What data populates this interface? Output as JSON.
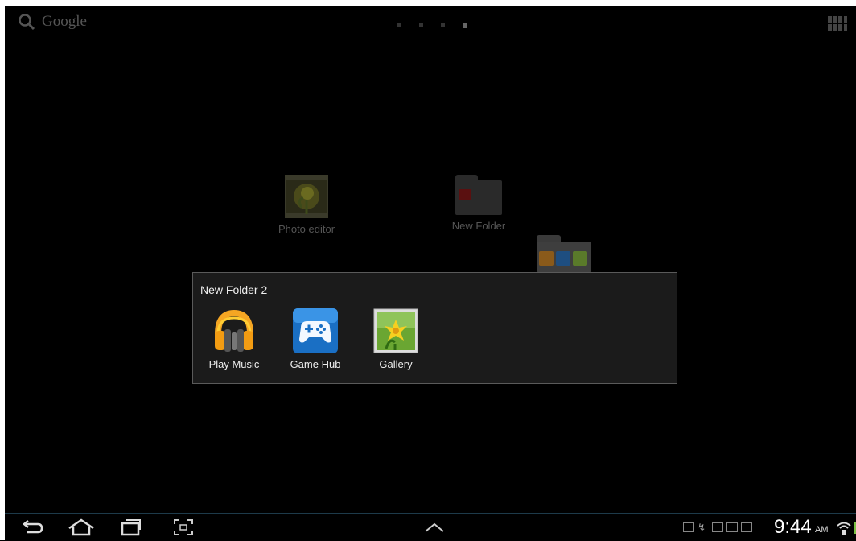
{
  "search": {
    "label": "Google",
    "icon": "search-icon"
  },
  "home_pages": {
    "count": 4,
    "active_index": 3
  },
  "desktop": {
    "photo_editor": {
      "label": "Photo editor",
      "icon": "photo-editor-icon"
    },
    "new_folder": {
      "label": "New Folder",
      "icon": "folder-icon"
    }
  },
  "folder_popup": {
    "title": "New Folder 2",
    "apps": [
      {
        "label": "Play Music",
        "icon": "headphones-icon"
      },
      {
        "label": "Game Hub",
        "icon": "gamepad-icon"
      },
      {
        "label": "Gallery",
        "icon": "gallery-flower-icon"
      }
    ]
  },
  "status": {
    "time": "9:44",
    "ampm": "AM",
    "battery_color": "#7bc043"
  }
}
